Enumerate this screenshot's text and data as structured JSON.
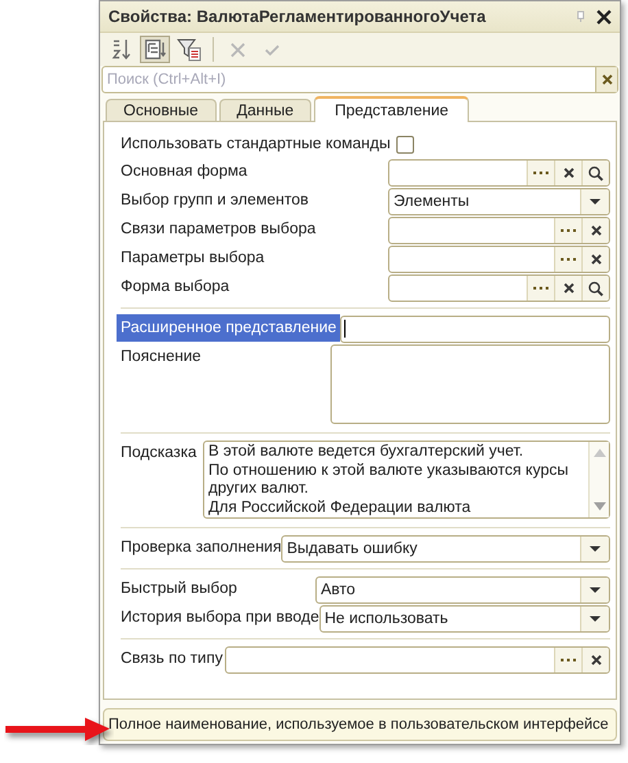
{
  "window": {
    "title": "Свойства: ВалютаРегламентированногоУчета"
  },
  "toolbar": [
    {
      "kind": "sort",
      "pressed": false,
      "disabled": false
    },
    {
      "kind": "tree",
      "pressed": true,
      "disabled": false
    },
    {
      "kind": "filter",
      "pressed": false,
      "disabled": false
    },
    {
      "kind": "separator"
    },
    {
      "kind": "cancel",
      "pressed": false,
      "disabled": true
    },
    {
      "kind": "accept",
      "pressed": false,
      "disabled": true
    }
  ],
  "search": {
    "placeholder": "Поиск (Ctrl+Alt+I)"
  },
  "tabs": [
    {
      "label": "Основные",
      "selected": false
    },
    {
      "label": "Данные",
      "selected": false
    },
    {
      "label": "Представление",
      "selected": true
    }
  ],
  "sections": [
    {
      "rows": [
        {
          "kind": "checkbox",
          "label": "Использовать стандартные команды",
          "checked": false
        },
        {
          "kind": "choice",
          "label": "Основная форма",
          "buttons": [
            {
              "kind": "select"
            },
            {
              "kind": "clear"
            },
            {
              "kind": "open"
            }
          ]
        },
        {
          "kind": "dropdown",
          "label": "Выбор групп и элементов",
          "value": "Элементы"
        },
        {
          "kind": "choice",
          "label": "Связи параметров выбора",
          "buttons": [
            {
              "kind": "select"
            },
            {
              "kind": "clear"
            }
          ]
        },
        {
          "kind": "choice",
          "label": "Параметры выбора",
          "buttons": [
            {
              "kind": "select"
            },
            {
              "kind": "clear"
            }
          ]
        },
        {
          "kind": "choice",
          "label": "Форма выбора",
          "buttons": [
            {
              "kind": "select"
            },
            {
              "kind": "clear"
            },
            {
              "kind": "open"
            }
          ]
        }
      ]
    },
    {
      "rows": [
        {
          "kind": "text",
          "label": "Расширенное представление",
          "selected": true,
          "focused": true
        },
        {
          "kind": "memo",
          "label": "Пояснение"
        }
      ]
    },
    {
      "rows": [
        {
          "kind": "memo",
          "label": "Подсказка",
          "scrollbar": true,
          "lines": [
            "В этой валюте ведется бухгалтерский учет.",
            "По отношению к этой валюте указываются курсы",
            "других валют.",
            "Для Российской Федерации валюта"
          ]
        }
      ]
    },
    {
      "rows": [
        {
          "kind": "dropdown",
          "label": "Проверка заполнения",
          "value": "Выдавать ошибку"
        }
      ]
    },
    {
      "rows": [
        {
          "kind": "dropdown",
          "label": "Быстрый выбор",
          "value": "Авто"
        },
        {
          "kind": "dropdown",
          "label": "История выбора при вводе",
          "value": "Не использовать"
        }
      ]
    },
    {
      "rows": [
        {
          "kind": "choice",
          "label": "Связь по типу",
          "buttons": [
            {
              "kind": "select"
            },
            {
              "kind": "clear"
            }
          ]
        }
      ]
    }
  ],
  "description": "Полное наименование, используемое в пользовательском интерфейсе"
}
